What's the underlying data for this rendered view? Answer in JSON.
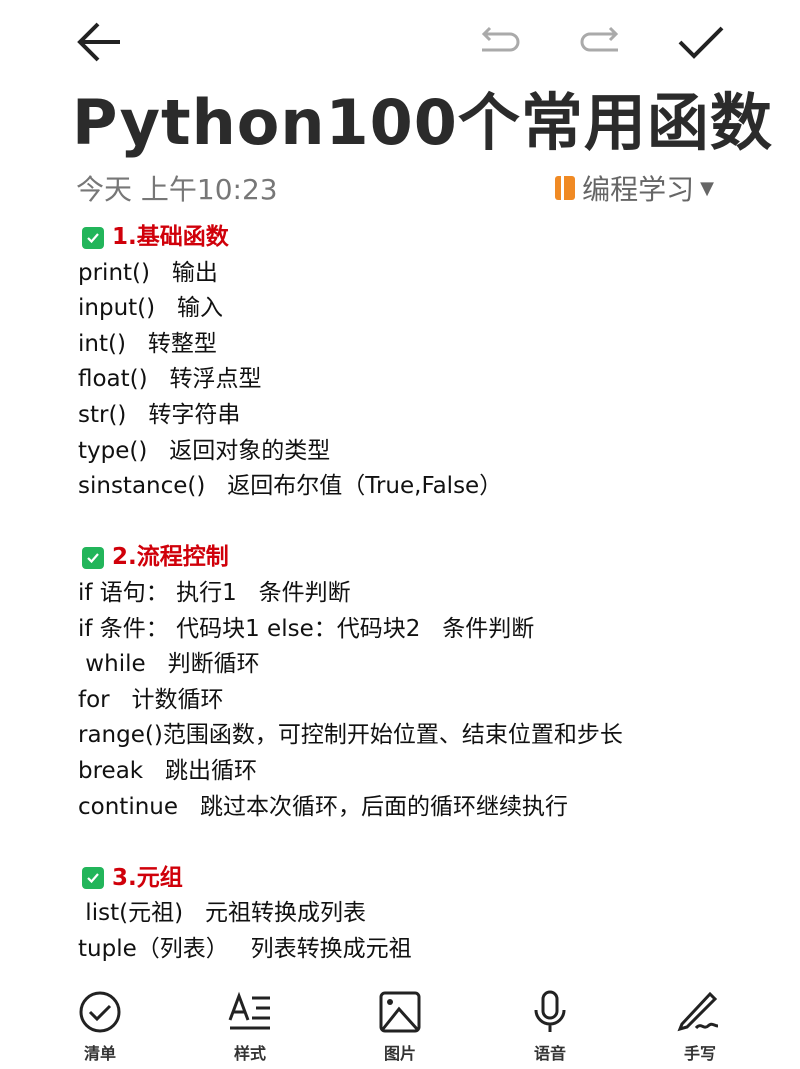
{
  "title": "Python100个常用函数",
  "meta": {
    "time": "今天 上午10:23",
    "folder": "编程学习"
  },
  "colors": {
    "heading": "#d0000a",
    "check": "#22b55a",
    "folder": "#f08a24"
  },
  "sections": [
    {
      "heading": "1.基础函数",
      "lines": [
        "print()   输出",
        "input()   输入",
        "int()   转整型",
        "float()   转浮点型",
        "str()   转字符串",
        "type()   返回对象的类型",
        "sinstance()   返回布尔值（True,False）"
      ]
    },
    {
      "heading": "2.流程控制",
      "lines": [
        "if 语句： 执行1   条件判断",
        "if 条件： 代码块1 else：代码块2   条件判断",
        " while   判断循环",
        "for   计数循环",
        "range()范围函数，可控制开始位置、结束位置和步长",
        "break   跳出循环",
        "continue   跳过本次循环，后面的循环继续执行"
      ]
    },
    {
      "heading": "3.元组",
      "lines": [
        " list(元祖)   元祖转换成列表",
        "tuple（列表）   列表转换成元祖"
      ]
    }
  ],
  "toolbar": [
    {
      "label": "清单",
      "icon": "checklist-icon"
    },
    {
      "label": "样式",
      "icon": "text-style-icon"
    },
    {
      "label": "图片",
      "icon": "image-icon"
    },
    {
      "label": "语音",
      "icon": "microphone-icon"
    },
    {
      "label": "手写",
      "icon": "handwriting-icon"
    }
  ]
}
